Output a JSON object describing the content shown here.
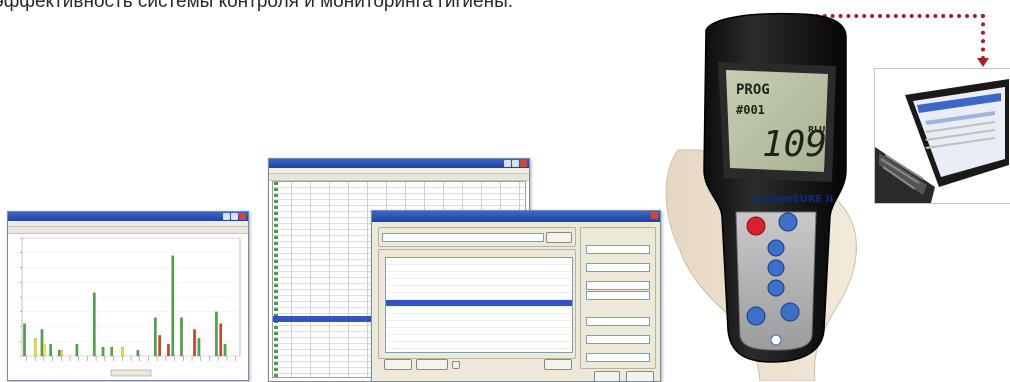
{
  "headline": "эффективность системы контроля и мониторинга гигиены.",
  "accent_color": "#a8202a",
  "chart_window": {
    "chart_data": {
      "type": "bar",
      "categories": [
        "1",
        "2",
        "3",
        "4",
        "5",
        "6",
        "7",
        "8",
        "9",
        "10",
        "11",
        "12",
        "13",
        "14",
        "15",
        "16",
        "17",
        "18",
        "19",
        "20",
        "21",
        "22",
        "23",
        "24",
        "25"
      ],
      "series": [
        {
          "color": "#4aa64a",
          "values": [
            22,
            0,
            18,
            8,
            4,
            0,
            8,
            0,
            43,
            6,
            6,
            0,
            0,
            4,
            0,
            26,
            0,
            68,
            26,
            0,
            12,
            0,
            30,
            8,
            0
          ]
        },
        {
          "color": "#f2e23a",
          "values": [
            0,
            12,
            8,
            0,
            4,
            0,
            0,
            0,
            0,
            0,
            0,
            6,
            0,
            0,
            0,
            0,
            0,
            0,
            0,
            0,
            0,
            0,
            0,
            0,
            0
          ]
        },
        {
          "color": "#e23a1e",
          "values": [
            0,
            0,
            0,
            0,
            0,
            0,
            0,
            0,
            0,
            0,
            0,
            0,
            0,
            0,
            0,
            14,
            8,
            0,
            0,
            18,
            0,
            0,
            22,
            0,
            0
          ]
        }
      ],
      "ylim": [
        0,
        80
      ]
    }
  },
  "device": {
    "screen_mode": "PROG",
    "screen_number": "#001",
    "screen_value": "109",
    "screen_unit": "RLU",
    "brand": "systemSURE II"
  }
}
